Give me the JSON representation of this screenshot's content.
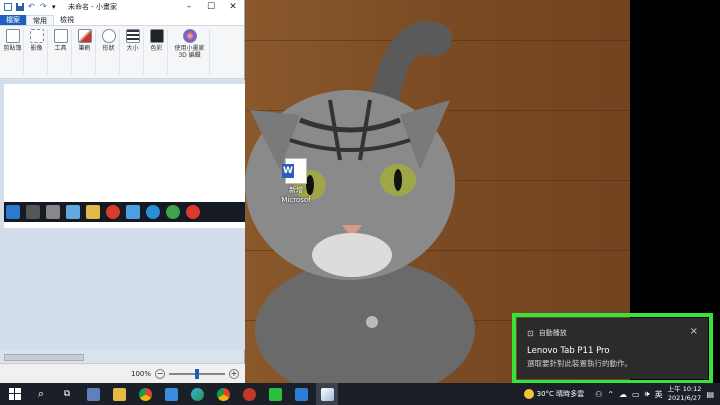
{
  "paint": {
    "title": "未命名 - 小畫家",
    "tabs": [
      "檔案",
      "常用",
      "檢視"
    ],
    "ribbon_groups": [
      "剪貼簿",
      "影像",
      "工具",
      "筆刷",
      "形狀",
      "大小",
      "色彩",
      "使用小畫家 3D 編輯"
    ],
    "zoom": "100%"
  },
  "desktop_icon": {
    "label_line1": "新增",
    "label_line2": "Microsof"
  },
  "toast": {
    "header": "自動播放",
    "close": "×",
    "device": "Lenovo Tab P11 Pro",
    "message": "選取要針對此裝置執行的動作。"
  },
  "taskbar": {
    "weather": "30°C  晴時多雲",
    "time": "上午 10:12",
    "date": "2021/6/27"
  },
  "colors": {
    "highlight": "#39e23b",
    "toast_bg": "#2b2b2b",
    "taskbar_bg": "#1a1f28",
    "file_tab": "#1e5fbf"
  }
}
